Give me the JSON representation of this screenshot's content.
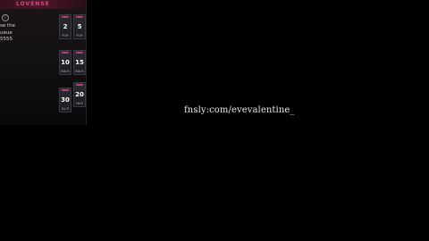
{
  "overlay": {
    "brand": "LOVENSE",
    "info_icon": "info-icon",
    "queue_line1": "se the",
    "queue_line2": "ueue",
    "queue_line3": "5555",
    "tiles": [
      {
        "value": "2",
        "sub": "FI-H"
      },
      {
        "value": "5",
        "sub": "FI-H"
      },
      {
        "value": "10",
        "sub": "K-B-H"
      },
      {
        "value": "15",
        "sub": "K-B-H"
      },
      {
        "value": "30",
        "sub": "K-I-P"
      },
      {
        "value": "20",
        "sub": "HI-H"
      }
    ]
  },
  "watermark": {
    "text": "fnsly:com/evevalentine_"
  },
  "colors": {
    "accent": "#e0457b",
    "background": "#000000"
  }
}
